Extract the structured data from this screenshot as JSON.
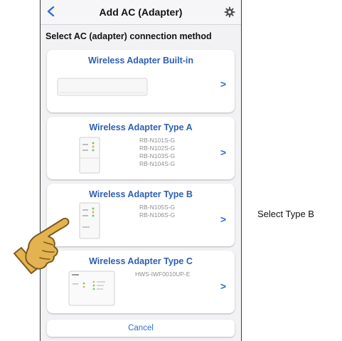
{
  "header": {
    "back_icon": "chevron-left-icon",
    "title": "Add AC (Adapter)",
    "settings_icon": "gear-icon"
  },
  "instruction": "Select AC (adapter) connection method",
  "options": [
    {
      "title": "Wireless Adapter Built-in",
      "models": []
    },
    {
      "title": "Wireless Adapter Type A",
      "models": [
        "RB-N101S-G",
        "RB-N102S-G",
        "RB-N103S-G",
        "RB-N104S-G"
      ]
    },
    {
      "title": "Wireless Adapter Type B",
      "models": [
        "RB-N105S-G",
        "RB-N106S-G"
      ]
    },
    {
      "title": "Wireless Adapter Type C",
      "models": [
        "HWS-IWF0010UP-E"
      ]
    }
  ],
  "chevron_glyph": ">",
  "cancel_label": "Cancel",
  "callout": "Select Type B",
  "colors": {
    "accent": "#2f6dd0",
    "title_blue": "#2f5fb2",
    "hand": "#e3b352"
  }
}
